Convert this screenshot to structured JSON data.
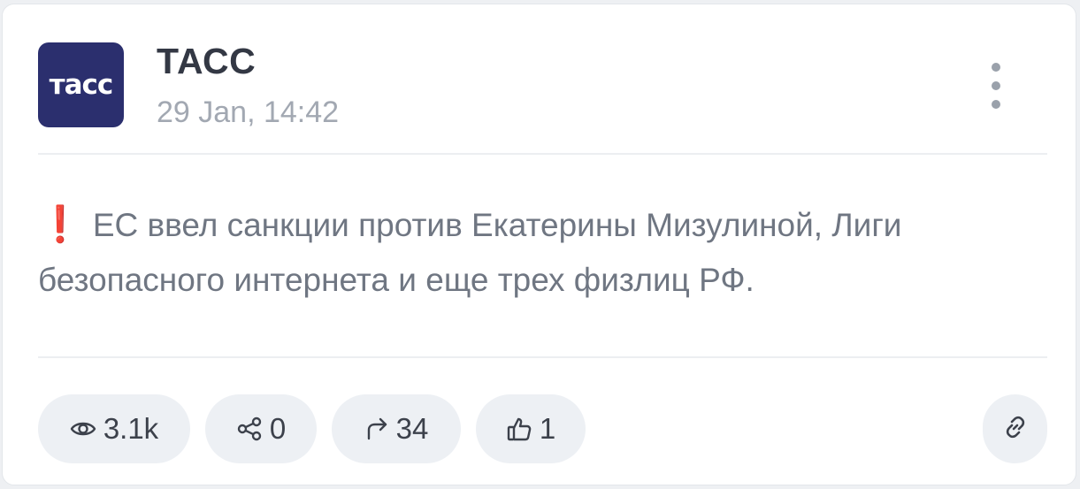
{
  "channel": {
    "name": "ТАСС",
    "logo_text": "тасс",
    "date": "29 Jan, 14:42"
  },
  "post": {
    "icon": "red-exclamation-emoji",
    "text": "ЕС ввел санкции против Екатерины Мизулиной, Лиги безопасного интернета и еще трех физлиц РФ."
  },
  "stats": {
    "views": "3.1k",
    "shares": "0",
    "forwards": "34",
    "likes": "1"
  },
  "colors": {
    "logo_bg": "#2b2f6e",
    "accent_red": "#e0242a",
    "pill_bg": "#edf0f4"
  }
}
